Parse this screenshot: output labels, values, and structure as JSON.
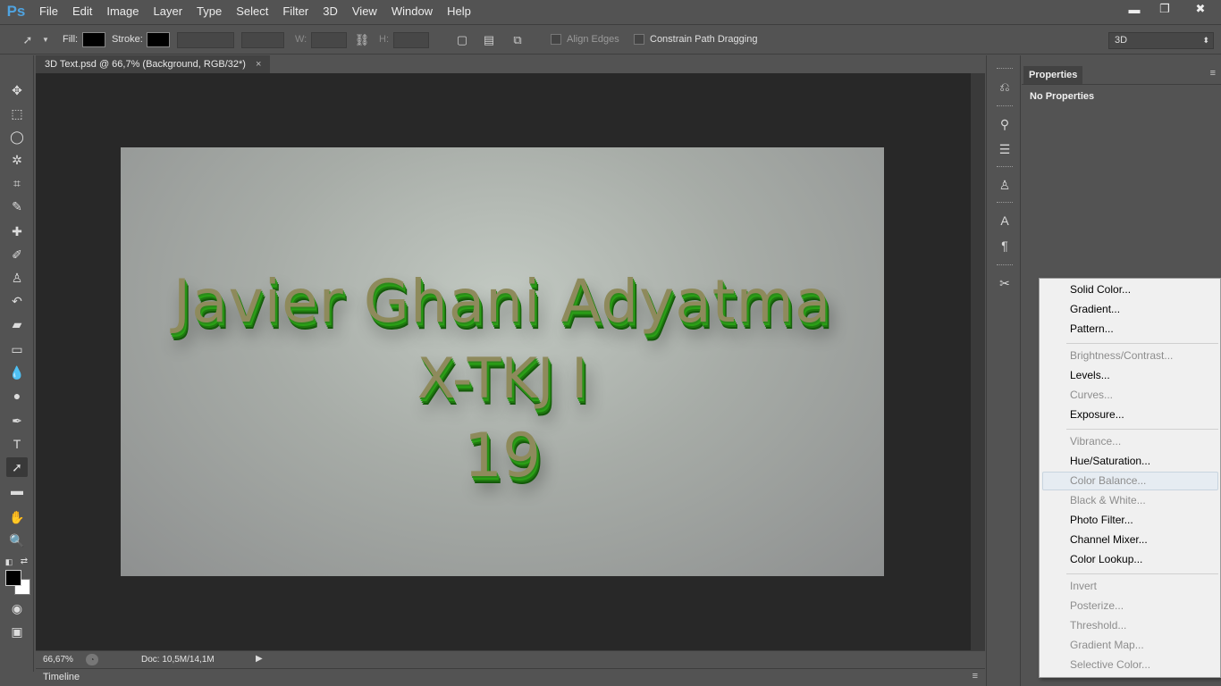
{
  "app": {
    "logo": "Ps",
    "menu": [
      "File",
      "Edit",
      "Image",
      "Layer",
      "Type",
      "Select",
      "Filter",
      "3D",
      "View",
      "Window",
      "Help"
    ]
  },
  "window_controls": {
    "minimize": "▬",
    "restore": "❐",
    "close": "✖"
  },
  "options": {
    "fill_label": "Fill:",
    "stroke_label": "Stroke:",
    "w_label": "W:",
    "h_label": "H:",
    "align_edges": "Align Edges",
    "constrain_path": "Constrain Path Dragging",
    "workspace": "3D"
  },
  "document": {
    "tab_title": "3D Text.psd @ 66,7% (Background, RGB/32*)",
    "close": "×",
    "image_text": {
      "line1": "Javier Ghani Adyatma",
      "line2": "X-TKJ I",
      "line3": "19"
    }
  },
  "status": {
    "zoom": "66,67%",
    "doc": "Doc: 10,5M/14,1M"
  },
  "timeline": {
    "label": "Timeline"
  },
  "properties": {
    "tab": "Properties",
    "empty": "No Properties"
  },
  "adjustment_menu": {
    "group1": [
      {
        "label": "Solid Color...",
        "enabled": true
      },
      {
        "label": "Gradient...",
        "enabled": true
      },
      {
        "label": "Pattern...",
        "enabled": true
      }
    ],
    "group2": [
      {
        "label": "Brightness/Contrast...",
        "enabled": false
      },
      {
        "label": "Levels...",
        "enabled": true
      },
      {
        "label": "Curves...",
        "enabled": false
      },
      {
        "label": "Exposure...",
        "enabled": true
      }
    ],
    "group3": [
      {
        "label": "Vibrance...",
        "enabled": false
      },
      {
        "label": "Hue/Saturation...",
        "enabled": true
      },
      {
        "label": "Color Balance...",
        "enabled": false
      },
      {
        "label": "Black & White...",
        "enabled": false
      },
      {
        "label": "Photo Filter...",
        "enabled": true
      },
      {
        "label": "Channel Mixer...",
        "enabled": true
      },
      {
        "label": "Color Lookup...",
        "enabled": true
      }
    ],
    "group4": [
      {
        "label": "Invert",
        "enabled": false
      },
      {
        "label": "Posterize...",
        "enabled": false
      },
      {
        "label": "Threshold...",
        "enabled": false
      },
      {
        "label": "Gradient Map...",
        "enabled": false
      },
      {
        "label": "Selective Color...",
        "enabled": false
      }
    ]
  }
}
